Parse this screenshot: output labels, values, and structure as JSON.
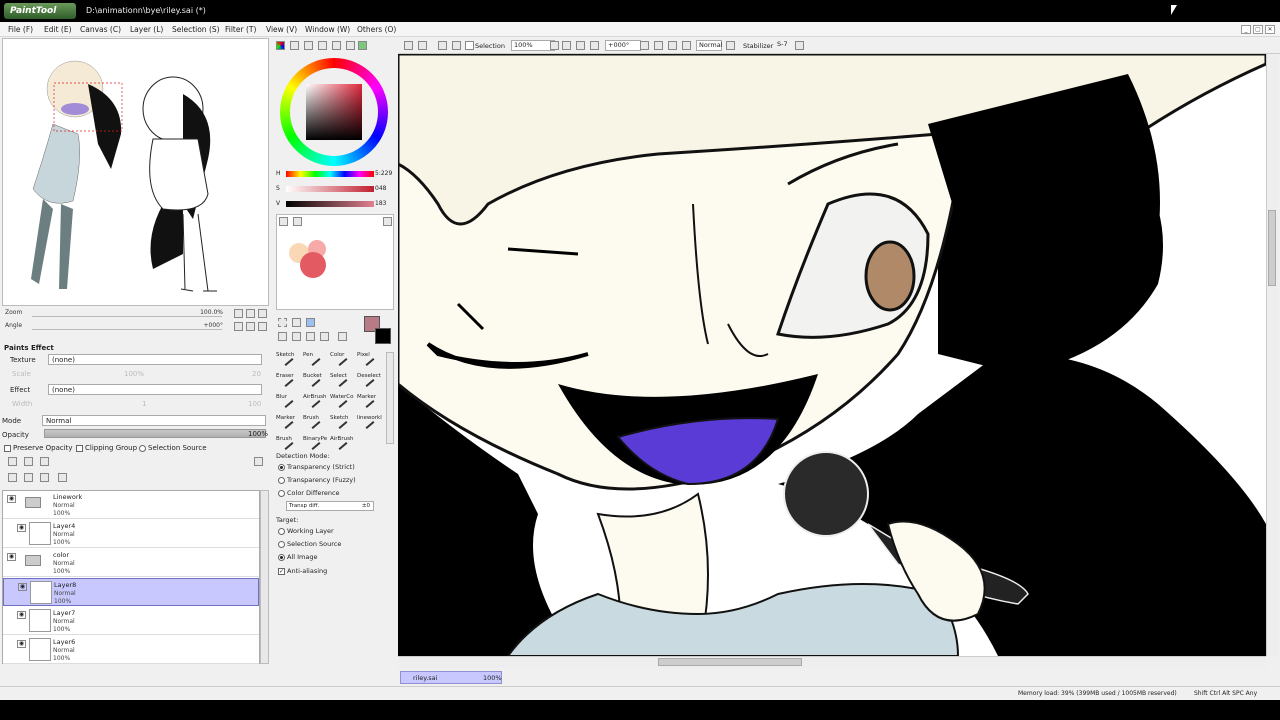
{
  "window": {
    "logo_text": "PaintTool SAI",
    "title": "D:\\animationn\\bye\\riley.sai (*)"
  },
  "menu": [
    "File (F)",
    "Edit (E)",
    "Canvas (C)",
    "Layer (L)",
    "Selection (S)",
    "Filter (T)",
    "View (V)",
    "Window (W)",
    "Others (O)"
  ],
  "navigator": {
    "zoom_label": "Zoom",
    "zoom_value": "100.0%",
    "angle_label": "Angle",
    "angle_value": "+000°"
  },
  "paints_effect": {
    "header": "Paints Effect",
    "texture_label": "Texture",
    "texture_value": "(none)",
    "scale_label": "Scale",
    "scale_value": "100%",
    "scale_num": "20",
    "effect_label": "Effect",
    "effect_value": "(none)",
    "width_label": "Width",
    "width_num": "1",
    "width_num2": "100"
  },
  "layer_props": {
    "mode_label": "Mode",
    "mode_value": "Normal",
    "opacity_label": "Opacity",
    "opacity_value": "100%",
    "preserve_opacity": "Preserve Opacity",
    "clipping_group": "Clipping Group",
    "selection_source": "Selection Source"
  },
  "layers": [
    {
      "name": "Linework",
      "mode": "Normal",
      "opacity": "100%",
      "type": "folder",
      "selected": false
    },
    {
      "name": "Layer4",
      "mode": "Normal",
      "opacity": "100%",
      "type": "layer",
      "selected": false
    },
    {
      "name": "color",
      "mode": "Normal",
      "opacity": "100%",
      "type": "folder",
      "selected": false
    },
    {
      "name": "Layer8",
      "mode": "Normal",
      "opacity": "100%",
      "type": "layer",
      "selected": true
    },
    {
      "name": "Layer7",
      "mode": "Normal",
      "opacity": "100%",
      "type": "layer",
      "selected": false
    },
    {
      "name": "Layer6",
      "mode": "Normal",
      "opacity": "100%",
      "type": "layer",
      "selected": false
    }
  ],
  "color_sliders": [
    {
      "label": "H",
      "value": "5:229"
    },
    {
      "label": "S",
      "value": "048"
    },
    {
      "label": "V",
      "value": "183"
    }
  ],
  "tools": [
    {
      "label": "Sketch",
      "col": 0,
      "row": 0
    },
    {
      "label": "Pen",
      "col": 1,
      "row": 0
    },
    {
      "label": "Color",
      "col": 2,
      "row": 0
    },
    {
      "label": "Pixel",
      "col": 3,
      "row": 0
    },
    {
      "label": "Eraser",
      "col": 0,
      "row": 1
    },
    {
      "label": "Bucket",
      "col": 1,
      "row": 1
    },
    {
      "label": "Select",
      "col": 2,
      "row": 1
    },
    {
      "label": "Deselect",
      "col": 3,
      "row": 1
    },
    {
      "label": "Blur",
      "col": 0,
      "row": 2
    },
    {
      "label": "AirBrush",
      "col": 1,
      "row": 2
    },
    {
      "label": "WaterCo",
      "col": 2,
      "row": 2
    },
    {
      "label": "Marker",
      "col": 3,
      "row": 2
    },
    {
      "label": "Marker",
      "col": 0,
      "row": 3
    },
    {
      "label": "Brush",
      "col": 1,
      "row": 3
    },
    {
      "label": "Sketch",
      "col": 2,
      "row": 3
    },
    {
      "label": "lineworkl",
      "col": 3,
      "row": 3
    },
    {
      "label": "Brush",
      "col": 0,
      "row": 4
    },
    {
      "label": "BinaryPe",
      "col": 1,
      "row": 4
    },
    {
      "label": "AirBrush",
      "col": 2,
      "row": 4
    }
  ],
  "tool_options": {
    "detection_mode_label": "Detection Mode:",
    "detection_options": [
      {
        "label": "Transparency (Strict)",
        "checked": true
      },
      {
        "label": "Transparency (Fuzzy)",
        "checked": false
      },
      {
        "label": "Color Difference",
        "checked": false
      }
    ],
    "transp_diff_label": "Transp diff.",
    "transp_diff_value": "±0",
    "target_label": "Target:",
    "target_options": [
      {
        "label": "Working Layer",
        "checked": false
      },
      {
        "label": "Selection Source",
        "checked": false
      },
      {
        "label": "All Image",
        "checked": true
      }
    ],
    "anti_aliasing": "Anti-aliasing"
  },
  "canvas_toolbar": {
    "selection_label": "Selection",
    "zoom_value": "100%",
    "angle_value": "+000°",
    "blend_mode": "Normal",
    "stabilizer_label": "Stabilizer",
    "stabilizer_value": "S-7"
  },
  "file_tab": {
    "name": "riley.sai",
    "zoom": "100%"
  },
  "status": {
    "memory": "Memory load: 39% (399MB used / 1005MB reserved)",
    "keys": "Shift Ctrl Alt SPC Any"
  },
  "colors": {
    "selected_layer_bg": "#c8c8ff",
    "purple_mouth": "#5b3bd6",
    "skin": "#fdfbef",
    "hair_light": "#f7f2e3",
    "eye_brown": "#b08a68",
    "shirt_blue": "#c9dbe0"
  }
}
